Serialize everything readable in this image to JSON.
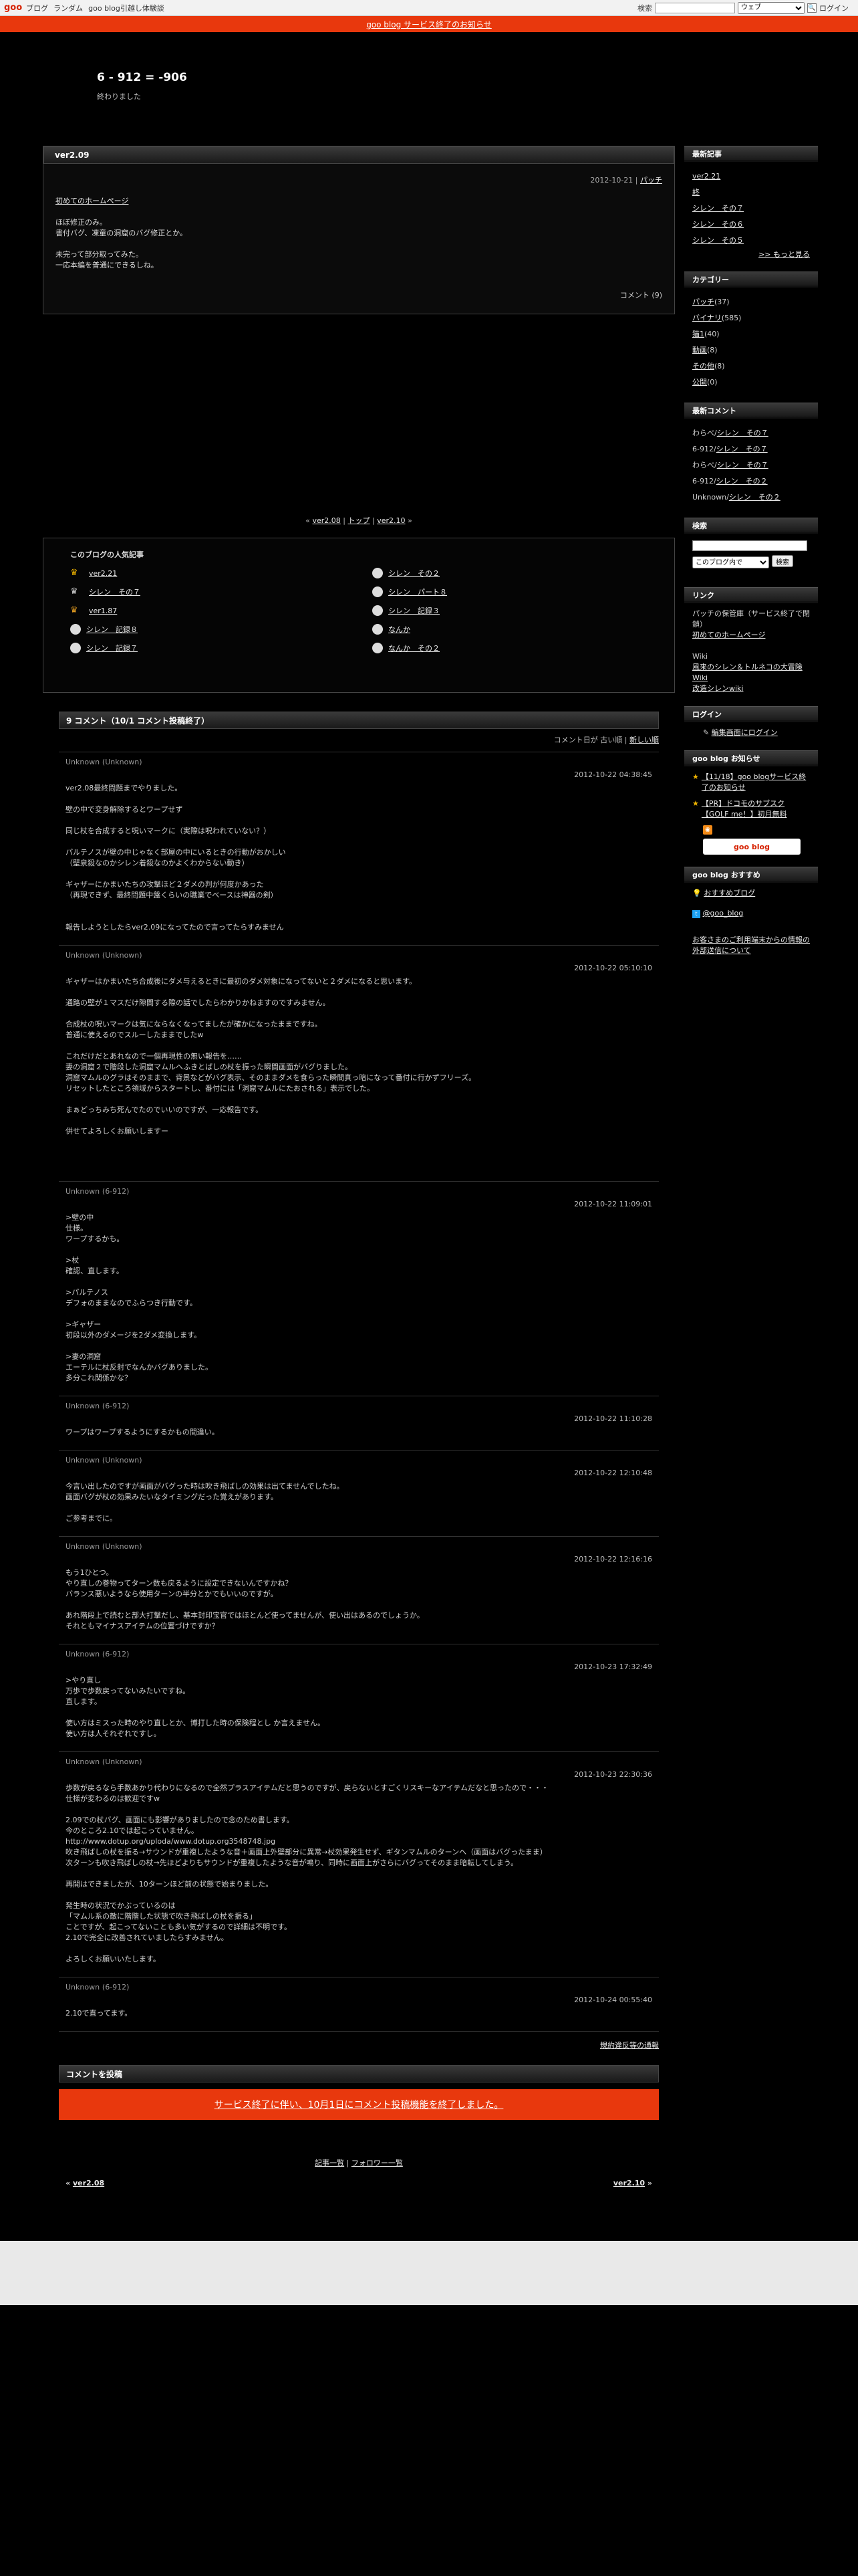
{
  "topbar": {
    "logo": "goo",
    "links": [
      "ブログ",
      "ランダム",
      "goo blog引越し体験談"
    ],
    "search_label": "検索",
    "search_select": "ウェブ",
    "login": "ログイン"
  },
  "notice": "goo blog サービス終了のお知らせ",
  "blog": {
    "title": "6 - 912 = -906",
    "desc": "終わりました"
  },
  "entry": {
    "title": "ver2.09",
    "date": "2012-10-21",
    "category": "パッチ",
    "link": "初めてのホームページ",
    "p1": "ほぼ修正のみ。\n書付バグ、凍童の洞窟のバグ修正とか。",
    "p2": "未完って部分取ってみた。\n一応本編を普通にできるしね。",
    "comment_link": "コメント (9)"
  },
  "pager": {
    "prev": "ver2.08",
    "top": "トップ",
    "next": "ver2.10"
  },
  "popular": {
    "title": "このブログの人気記事",
    "items": [
      "ver2.21",
      "シレン　その２",
      "シレン　その７",
      "シレン　パート８",
      "ver1.87",
      "シレン　記録３",
      "シレン　記録８",
      "なんか",
      "シレン　記録７",
      "なんか　その２"
    ]
  },
  "comments": {
    "title": "9 コメント（10/1 コメント投稿終了）",
    "sort_text": "コメント日が",
    "sort_old": "古い順",
    "sort_new": "新しい順",
    "list": [
      {
        "author": "Unknown",
        "sub": "(Unknown)",
        "date": "2012-10-22 04:38:45",
        "text": "ver2.08最終問題までやりました。\n\n壁の中で変身解除するとワープせず\n\n同じ杖を合成すると呪いマークに（実際は呪われていない？）\n\nパルテノスが壁の中じゃなく部屋の中にいるときの行動がおかしい\n（壁泉殺なのかシレン着殺なのかよくわからない動き）\n\nギャザーにかまいたちの攻撃ほど２ダメの判が何度かあった\n（再現できず、最終問題中盤くらいの職業でベースは神器の剣）\n\n\n報告しようとしたらver2.09になってたので言ってたらすみません"
      },
      {
        "author": "Unknown",
        "sub": "(Unknown)",
        "date": "2012-10-22 05:10:10",
        "text": "ギャザーはかまいたち合成後にダメ与えるときに最初のダメ対象になってないと２ダメになると思います。\n\n通路の壁が１マスだけ隙間する際の話でしたらわかりかねますのですみません。\n\n合成杖の呪いマークは気にならなくなってましたが確かになったままですね。\n普通に使えるのでスルーしたままでしたw\n\nこれだけだとあれなので一個再現性の無い報告を……\n妻の洞窟２で階段した洞窟マムルへふきとばしの杖を振った瞬間画面がバグりました。\n洞窟マムルのグラはそのままで、背景などがバグ表示、そのままダメを食らった瞬間真っ暗になって番付に行かずフリーズ。\nリセットしたところ領域からスタートし、番付には「洞窟マムルにたおされる」表示でした。\n\nまぁどっちみち死んでたのでいいのですが、一応報告です。\n\n併せてよろしくお願いしますー\n\n\n\n"
      },
      {
        "author": "Unknown",
        "sub": "(6-912)",
        "date": "2012-10-22 11:09:01",
        "text": ">壁の中\n仕様。\nワープするかも。\n\n>杖\n確認、直します。\n\n>パルテノス\nデフォのままなのでふらつき行動です。\n\n>ギャザー\n初段以外のダメージを2ダメ変換します。\n\n>妻の洞窟\nエーテルに杖反射でなんかバグありました。\n多分これ関係かな？"
      },
      {
        "author": "Unknown",
        "sub": "(6-912)",
        "date": "2012-10-22 11:10:28",
        "text": "ワープはワープするようにするかもの間違い。"
      },
      {
        "author": "Unknown",
        "sub": "(Unknown)",
        "date": "2012-10-22 12:10:48",
        "text": "今言い出したのですが画面がバグった時は吹き飛ばしの効果は出てませんでしたね。\n画面バグが杖の効果みたいなタイミングだった覚えがあります。\n\nご参考までに。"
      },
      {
        "author": "Unknown",
        "sub": "(Unknown)",
        "date": "2012-10-22 12:16:16",
        "text": "もう1ひとつ。\nやり直しの巻物ってターン数も戻るように設定できないんですかね？\nバランス悪いようなら使用ターンの半分とかでもいいのですが。\n\nあれ階段上で読むと部大打撃だし、基本封印宝官ではほとんど使ってませんが、使い出はあるのでしょうか。\nそれともマイナスアイテムの位置づけですか？"
      },
      {
        "author": "Unknown",
        "sub": "(6-912)",
        "date": "2012-10-23 17:32:49",
        "text": ">やり直し\n万歩で歩数戻ってないみたいですね。\n直します。\n\n使い方はミスった時のやり直しとか、博打した時の保険程とし か言えません。\n使い方は人それぞれですし。"
      },
      {
        "author": "Unknown",
        "sub": "(Unknown)",
        "date": "2012-10-23 22:30:36",
        "text": "歩数が戻るなら手数あかり代わりになるので全然プラスアイテムだと思うのですが、戻らないとすごくリスキーなアイテムだなと思ったので・・・\n仕様が変わるのは歓迎ですw\n\n2.09での杖バグ、画面にも影響がありましたので念のため書します。\n今のところ2.10では起こっていません。\nhttp://www.dotup.org/uploda/www.dotup.org3548748.jpg\n吹き飛ばしの杖を振る→サウンドが重複したような音＋画面上外壁部分に異常→杖効果発生せず、ギタンマムルのターンへ（画面はバグったまま）\n次ターンも吹き飛ばしの杖→先ほどよりもサウンドが重複したような音が鳴り、同時に画面上がさらにバグってそのまま暗転してしまう。\n\n再開はできましたが、10ターンほど前の状態で始まりました。\n\n発生時の状況でかぶっているのは\n「マムル系の敵に階階した状態で吹き飛ばしの杖を振る」\nことですが、起こってないことも多い気がするので詳細は不明です。\n2.10で完全に改善されていましたらすみません。\n\nよろしくお願いいたします。"
      },
      {
        "author": "Unknown",
        "sub": "(6-912)",
        "date": "2012-10-24 00:55:40",
        "text": "2.10で直ってます。"
      }
    ],
    "tb_link": "規約違反等の通報"
  },
  "post": {
    "title": "コメントを投稿",
    "closed": "サービス終了に伴い、10月1日にコメント投稿機能を終了しました。"
  },
  "footer": {
    "list_link": "記事一覧",
    "follow_link": "フォロワー一覧",
    "prev": "ver2.08",
    "next": "ver2.10"
  },
  "sidebar": {
    "recent_title": "最新記事",
    "recent": [
      "ver2.21",
      "終",
      "シレン　その７",
      "シレン　その６",
      "シレン　その５"
    ],
    "more": ">> もっと見る",
    "cat_title": "カテゴリー",
    "cats": [
      {
        "name": "パッチ",
        "count": "(37)"
      },
      {
        "name": "バイナリ",
        "count": "(585)"
      },
      {
        "name": "猫1",
        "count": "(40)"
      },
      {
        "name": "動画",
        "count": "(8)"
      },
      {
        "name": "その他",
        "count": "(8)"
      },
      {
        "name": "公開",
        "count": "(0)"
      }
    ],
    "rc_title": "最新コメント",
    "rcs": [
      {
        "who": "わらべ/",
        "what": "シレン　その７"
      },
      {
        "who": "6-912/",
        "what": "シレン　その７"
      },
      {
        "who": "わらべ/",
        "what": "シレン　その７"
      },
      {
        "who": "6-912/",
        "what": "シレン　その２"
      },
      {
        "who": "Unknown/",
        "what": "シレン　その２"
      }
    ],
    "search_title": "検索",
    "search_select": "このブログ内で",
    "search_btn": "検索",
    "link_title": "リンク",
    "link1_text": "パッチの保管庫（サービス終了で閉鎖）",
    "link1": "初めてのホームページ",
    "wiki_label": "Wiki",
    "wiki1": "風来のシレン＆トルネコの大冒険 Wiki",
    "wiki2": "改造シレンwiki",
    "login_title": "ログイン",
    "login_link": "編集画面にログイン",
    "info_title": "goo blog お知らせ",
    "info1": "【11/18】goo blogサービス終了のお知らせ",
    "info2": "【PR】ドコモのサブスク【GOLF me！】初月無料",
    "goo_btn": "goo blog",
    "rec_title": "goo blog おすすめ",
    "rec1": "おすすめブログ",
    "twitter": "@goo_blog",
    "notice_link": "お客さまのご利用端末からの情報の外部送信について"
  },
  "colors": {
    "accent": "#e8380d",
    "bg": "#000000"
  }
}
